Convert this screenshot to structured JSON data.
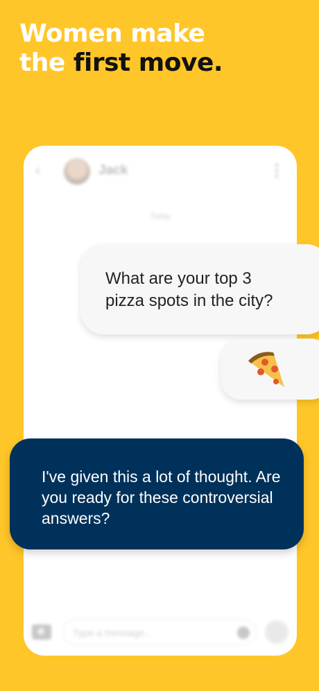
{
  "headline": {
    "line1": "Women make",
    "line2_light": "the",
    "line2_dark": "first move."
  },
  "chat": {
    "contact_name": "Jack",
    "day_label": "Today",
    "input_placeholder": "Type a message...",
    "messages": [
      {
        "side": "right",
        "text": "What are your top 3 pizza spots in the city?"
      },
      {
        "side": "right",
        "icon": "pizza-icon"
      },
      {
        "side": "left",
        "text": "I've given this a lot of thought. Are you ready for these controversial answers?"
      }
    ]
  },
  "colors": {
    "background": "#FFC629",
    "answer_bubble": "#00315A",
    "question_bubble": "#F7F7F7"
  }
}
